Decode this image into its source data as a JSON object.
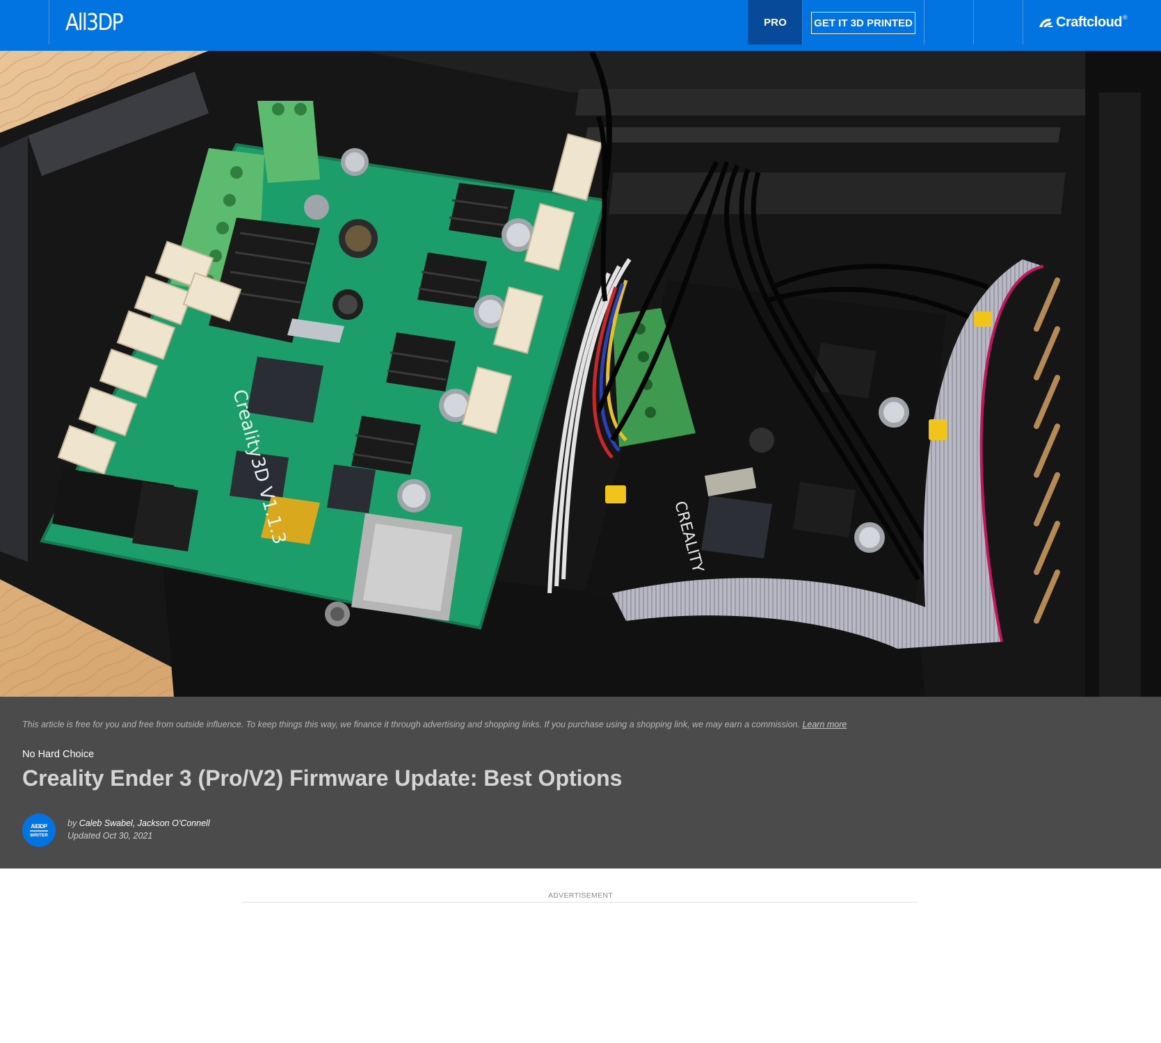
{
  "header": {
    "logo_text": "All3DP",
    "pro_label": "PRO",
    "print_button_label": "GET IT 3D PRINTED",
    "partner_logo": "Craftcloud",
    "partner_mark": "®",
    "brand_color": "#0274e1"
  },
  "hero": {
    "icon": "creality-mainboard-photo"
  },
  "article": {
    "disclaimer_text": "This article is free for you and free from outside influence. To keep things this way, we finance it through advertising and shopping links. If you purchase using a shopping link, we may earn a commission.",
    "learn_more_label": "Learn more",
    "kicker": "No Hard Choice",
    "title": "Creality Ender 3 (Pro/V2) Firmware Update: Best Options",
    "author_badge_line1": "All3DP",
    "author_badge_line2": "WRITER",
    "by_prefix": "by",
    "authors": "Caleb Swabel, Jackson O'Connell",
    "updated": "Updated Oct 30, 2021"
  },
  "ad": {
    "label": "ADVERTISEMENT"
  }
}
